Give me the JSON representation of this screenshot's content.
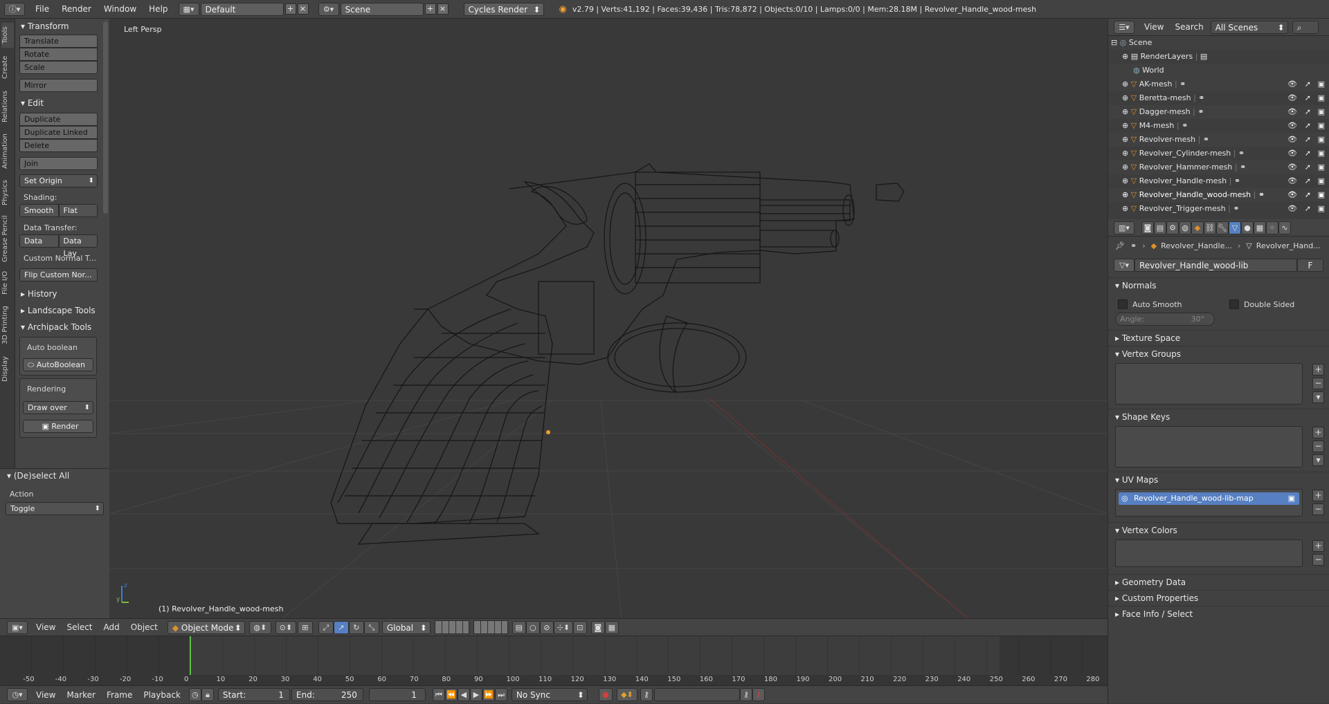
{
  "topbar": {
    "menus": [
      "File",
      "Render",
      "Window",
      "Help"
    ],
    "layout": "Default",
    "scene": "Scene",
    "engine": "Cycles Render",
    "stats": "v2.79 | Verts:41,192 | Faces:39,436 | Tris:78,872 | Objects:0/10 | Lamps:0/0 | Mem:28.18M | Revolver_Handle_wood-mesh"
  },
  "tabs": [
    "Tools",
    "Create",
    "Relations",
    "Animation",
    "Physics",
    "Grease Pencil",
    "File I/O",
    "3D Printing",
    "Display"
  ],
  "toolshelf": {
    "transform_title": "Transform",
    "transform": [
      "Translate",
      "Rotate",
      "Scale"
    ],
    "mirror": "Mirror",
    "edit_title": "Edit",
    "edit": [
      "Duplicate",
      "Duplicate Linked",
      "Delete"
    ],
    "join": "Join",
    "set_origin": "Set Origin",
    "shading_label": "Shading:",
    "smooth": "Smooth",
    "flat": "Flat",
    "data_transfer_label": "Data Transfer:",
    "data": "Data",
    "data_lay": "Data Lay",
    "custom_normal": "Custom Normal T...",
    "flip_custom": "Flip Custom Nor...",
    "history": "History",
    "landscape": "Landscape Tools",
    "archipack": "Archipack Tools",
    "auto_boolean_label": "Auto boolean",
    "auto_boolean_btn": "AutoBoolean",
    "rendering_label": "Rendering",
    "draw_over": "Draw over",
    "render_btn": "Render"
  },
  "operator": {
    "title": "(De)select All",
    "action_label": "Action",
    "action_value": "Toggle"
  },
  "viewport": {
    "view_name": "Left Persp",
    "object_label": "(1) Revolver_Handle_wood-mesh"
  },
  "vp_header": {
    "menus": [
      "View",
      "Select",
      "Add",
      "Object"
    ],
    "mode": "Object Mode",
    "orientation": "Global"
  },
  "timeline": {
    "ticks": [
      "-50",
      "-40",
      "-30",
      "-20",
      "-10",
      "0",
      "10",
      "20",
      "30",
      "40",
      "50",
      "60",
      "70",
      "80",
      "90",
      "100",
      "110",
      "120",
      "130",
      "140",
      "150",
      "160",
      "170",
      "180",
      "190",
      "200",
      "210",
      "220",
      "230",
      "240",
      "250",
      "260",
      "270",
      "280"
    ],
    "menus": [
      "View",
      "Marker",
      "Frame",
      "Playback"
    ],
    "start_label": "Start:",
    "start_value": "1",
    "end_label": "End:",
    "end_value": "250",
    "current": "1",
    "sync": "No Sync"
  },
  "outliner": {
    "menus": [
      "View",
      "Search"
    ],
    "filter": "All Scenes",
    "scene": "Scene",
    "render_layers": "RenderLayers",
    "world": "World",
    "objects": [
      "AK-mesh",
      "Beretta-mesh",
      "Dagger-mesh",
      "M4-mesh",
      "Revolver-mesh",
      "Revolver_Cylinder-mesh",
      "Revolver_Hammer-mesh",
      "Revolver_Handle-mesh",
      "Revolver_Handle_wood-mesh",
      "Revolver_Trigger-mesh"
    ]
  },
  "properties": {
    "breadcrumb_object": "Revolver_Handle...",
    "breadcrumb_data": "Revolver_Hand...",
    "datablock": "Revolver_Handle_wood-lib",
    "fake_user": "F",
    "normals_title": "Normals",
    "auto_smooth": "Auto Smooth",
    "double_sided": "Double Sided",
    "angle": "Angle:",
    "angle_value": "30°",
    "texture_space": "Texture Space",
    "vertex_groups": "Vertex Groups",
    "shape_keys": "Shape Keys",
    "uv_maps": "UV Maps",
    "uv_map_name": "Revolver_Handle_wood-lib-map",
    "vertex_colors": "Vertex Colors",
    "geometry_data": "Geometry Data",
    "custom_props": "Custom Properties",
    "face_info": "Face Info / Select"
  }
}
